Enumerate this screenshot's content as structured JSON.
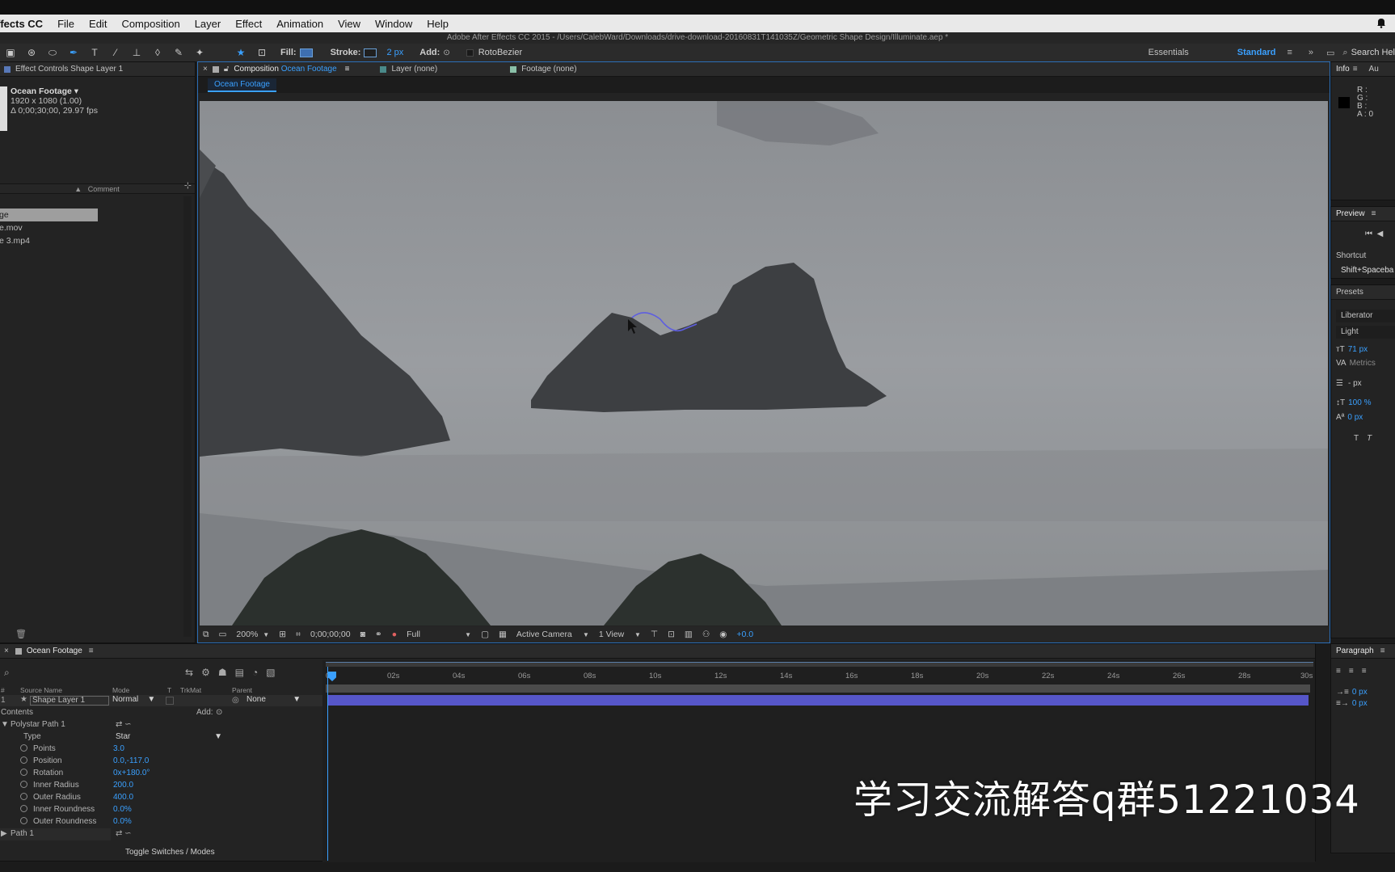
{
  "menubar": {
    "app_name": "ffects CC",
    "items": [
      "File",
      "Edit",
      "Composition",
      "Layer",
      "Effect",
      "Animation",
      "View",
      "Window",
      "Help"
    ]
  },
  "titlebar": {
    "text": "Adobe After Effects CC 2015 - /Users/CalebWard/Downloads/drive-download-20160831T141035Z/Geometric Shape Design/Illuminate.aep *"
  },
  "toolbar": {
    "fill_label": "Fill:",
    "stroke_label": "Stroke:",
    "stroke_width": "2 px",
    "add_label": "Add:",
    "rotobezier_label": "RotoBezier",
    "workspaces": [
      "Essentials",
      "Standard"
    ],
    "search_label": "Search Hel"
  },
  "project": {
    "tab_label": "Effect Controls Shape Layer 1",
    "footage_name": "Ocean Footage ▾",
    "footage_size": "1920 x 1080 (1.00)",
    "footage_duration": "Δ 0;00;30;00, 29.97 fps",
    "comment_col": "Comment",
    "items": [
      "ge",
      "e.mov",
      "e 3.mp4"
    ]
  },
  "comp": {
    "tabs": [
      "Composition",
      "Ocean Footage",
      "Layer (none)",
      "Footage (none)"
    ],
    "chip": "Ocean Footage",
    "footer": {
      "zoom": "200%",
      "timecode": "0;00;00;00",
      "resolution": "Full",
      "camera": "Active Camera",
      "views": "1 View",
      "exposure": "+0.0"
    }
  },
  "info": {
    "tabs": [
      "Info",
      "Au"
    ],
    "rgba": [
      "R :",
      "G :",
      "B :",
      "A : 0"
    ]
  },
  "preview": {
    "title": "Preview",
    "shortcut_label": "Shortcut",
    "shortcut_value": "Shift+Spaceba"
  },
  "character": {
    "presets_label": "Presets",
    "font": "Liberator",
    "style": "Light",
    "size": "71 px",
    "kerning": "Metrics",
    "leading": "- px",
    "vscale": "100 %",
    "baseline": "0 px"
  },
  "paragraph": {
    "title": "Paragraph",
    "indent1": "0 px",
    "indent2": "0 px"
  },
  "timeline": {
    "tab_label": "Ocean Footage",
    "columns": [
      "#",
      "Source Name",
      "Mode",
      "T",
      "TrkMat",
      "Parent"
    ],
    "layer": {
      "index": "1",
      "name": "Shape Layer 1",
      "mode": "Normal",
      "parent": "None"
    },
    "contents_label": "Contents",
    "add_label": "Add:",
    "group": "Polystar Path 1",
    "type_label": "Type",
    "type_value": "Star",
    "props": [
      {
        "label": "Points",
        "value": "3.0"
      },
      {
        "label": "Position",
        "value": "0.0,-117.0"
      },
      {
        "label": "Rotation",
        "value": "0x+180.0°"
      },
      {
        "label": "Inner Radius",
        "value": "200.0"
      },
      {
        "label": "Outer Radius",
        "value": "400.0"
      },
      {
        "label": "Inner Roundness",
        "value": "0.0%"
      },
      {
        "label": "Outer Roundness",
        "value": "0.0%"
      }
    ],
    "path_label": "Path 1",
    "toggle_label": "Toggle Switches / Modes",
    "ruler": [
      "0s",
      "02s",
      "04s",
      "06s",
      "08s",
      "10s",
      "12s",
      "14s",
      "16s",
      "18s",
      "20s",
      "22s",
      "24s",
      "26s",
      "28s",
      "30s"
    ]
  },
  "watermark": "学习交流解答q群51221034",
  "colors": {
    "accent": "#3aa0ff",
    "layer_bar": "#5656c9",
    "panel_bg": "#232323"
  }
}
